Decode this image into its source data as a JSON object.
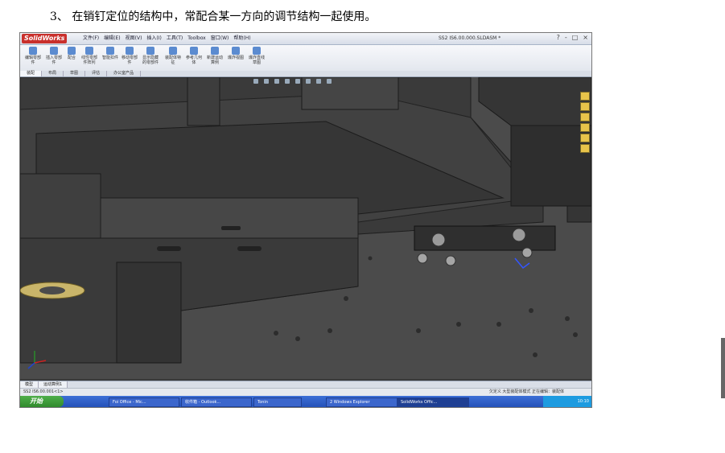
{
  "caption": "3、 在销钉定位的结构中，常配合某一方向的调节结构一起使用。",
  "window": {
    "logo": "SolidWorks",
    "menus": [
      "文件(F)",
      "编辑(E)",
      "视图(V)",
      "插入(I)",
      "工具(T)",
      "Toolbox",
      "窗口(W)",
      "帮助(H)"
    ],
    "doc_title": "SS2 IS6.00.000.SLDASM *",
    "buttons": [
      "?",
      "-",
      "□",
      "×"
    ]
  },
  "ribbon": {
    "tools": [
      "编辑零部件",
      "插入零部件",
      "配合",
      "线性零部件阵列",
      "智能扣件",
      "移动零部件",
      "显示隐藏的零部件",
      "装配体特征",
      "参考几何体",
      "新建运动算例",
      "爆炸视图",
      "爆炸直线草图"
    ]
  },
  "tabs": [
    "装配",
    "布局",
    "草图",
    "评估",
    "办公室产品"
  ],
  "bottom_tabs": [
    "模型",
    "运动算例1"
  ],
  "status": {
    "left": "SS2 IS6.00.001<1>",
    "right": "欠定义  大型装配体模式  正在编辑：装配体"
  },
  "taskbar": {
    "start": "开始",
    "items": [
      "Foi Office - Mic...",
      "收件箱 - Outlook...",
      "Tonin",
      "2 Windows Explorer",
      "SolidWorks Offic..."
    ],
    "clock": "10:10"
  },
  "colors": {
    "titlebar": "#dfe4ec",
    "model_dark": "#3a3a3a",
    "model_mid": "#555555",
    "model_light": "#6a6a6a",
    "brass": "#c9b56a",
    "taskbar": "#2451b8"
  }
}
